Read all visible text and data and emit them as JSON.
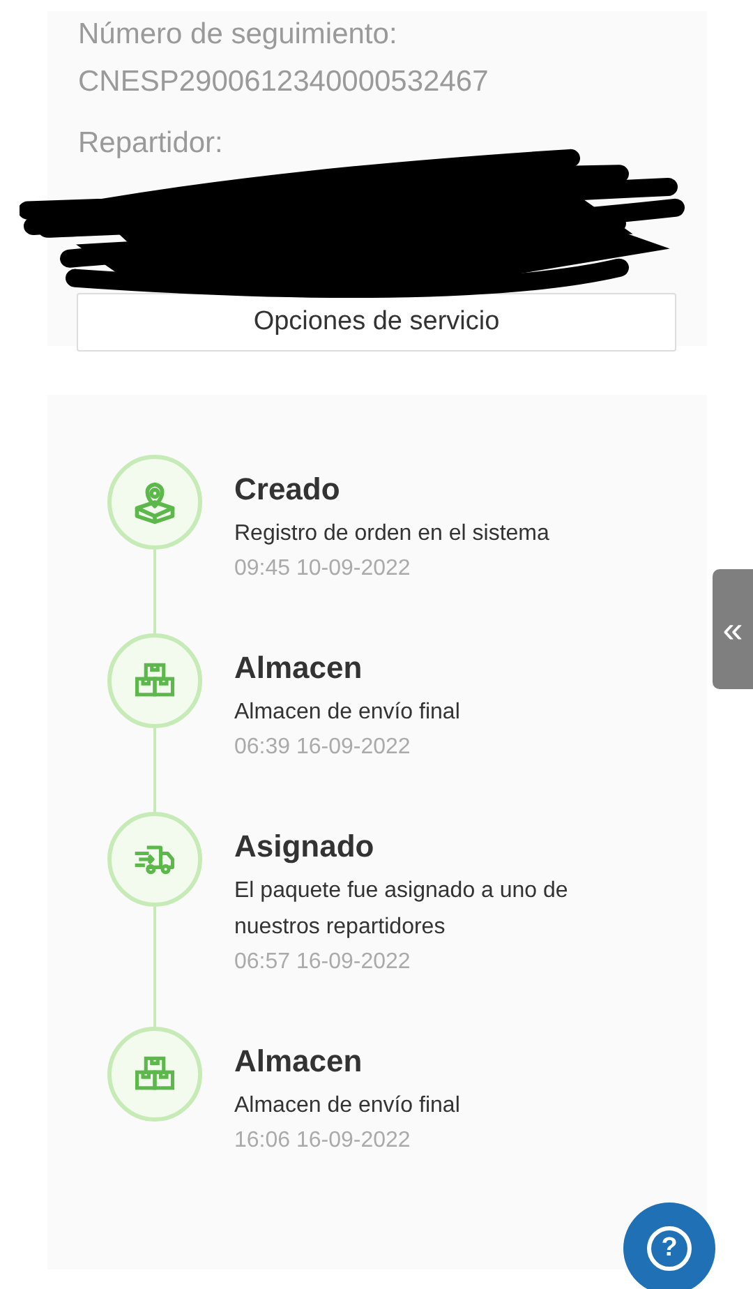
{
  "tracking": {
    "number_label": "Número de seguimiento:",
    "number": "CNESP2900612340000532467",
    "courier_label": "Repartidor:",
    "service_button": "Opciones de servicio"
  },
  "timeline": [
    {
      "kind": "location",
      "title": "Creado",
      "description": "Registro de orden en el sistema",
      "time": "09:45 10-09-2022"
    },
    {
      "kind": "boxes",
      "title": "Almacen",
      "description": "Almacen de envío final",
      "time": "06:39 16-09-2022"
    },
    {
      "kind": "truck",
      "title": "Asignado",
      "description": "El paquete fue asignado a uno de nuestros repartidores",
      "time": "06:57 16-09-2022"
    },
    {
      "kind": "boxes",
      "title": "Almacen",
      "description": "Almacen de envío final",
      "time": "16:06 16-09-2022"
    }
  ],
  "side_tab": {
    "label": "«"
  },
  "help_button": {
    "label": "?"
  }
}
